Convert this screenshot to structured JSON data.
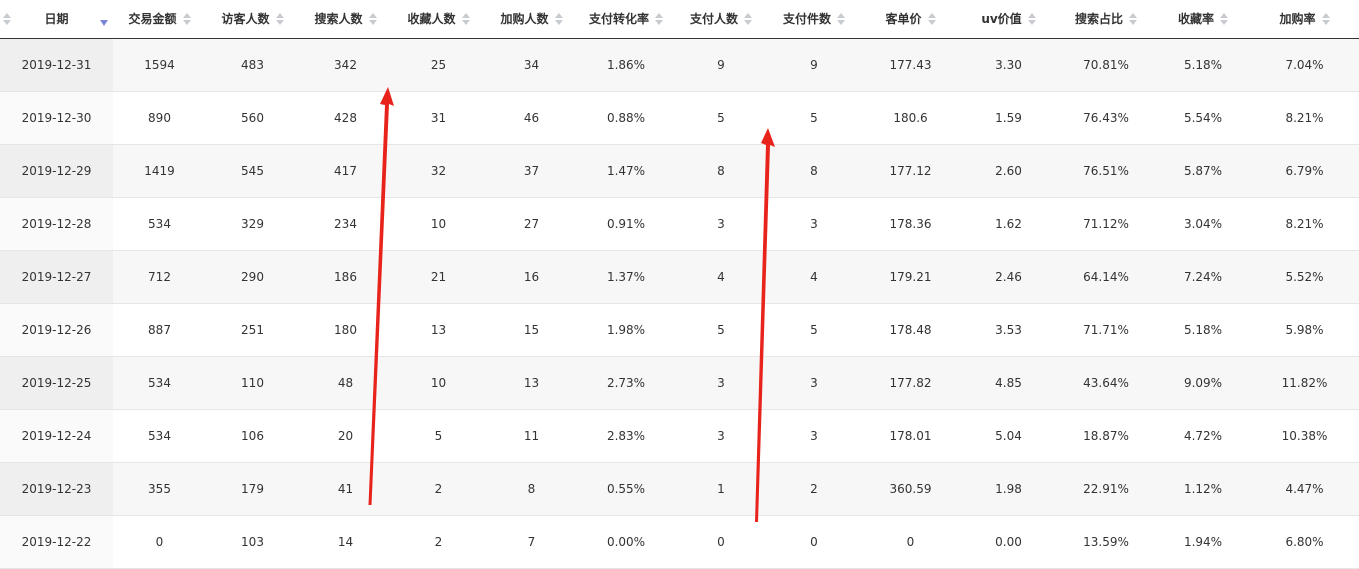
{
  "table": {
    "columns": [
      {
        "key": "date",
        "label": "日期"
      },
      {
        "key": "amount",
        "label": "交易金额"
      },
      {
        "key": "visitors",
        "label": "访客人数"
      },
      {
        "key": "search_users",
        "label": "搜索人数"
      },
      {
        "key": "fav_users",
        "label": "收藏人数"
      },
      {
        "key": "cart_users",
        "label": "加购人数"
      },
      {
        "key": "pay_conv",
        "label": "支付转化率"
      },
      {
        "key": "pay_users",
        "label": "支付人数"
      },
      {
        "key": "pay_items",
        "label": "支付件数"
      },
      {
        "key": "avg_price",
        "label": "客单价"
      },
      {
        "key": "uv_value",
        "label": "uv价值"
      },
      {
        "key": "search_ratio",
        "label": "搜索占比"
      },
      {
        "key": "fav_rate",
        "label": "收藏率"
      },
      {
        "key": "cart_rate",
        "label": "加购率"
      }
    ],
    "rows": [
      [
        "2019-12-31",
        "1594",
        "483",
        "342",
        "25",
        "34",
        "1.86%",
        "9",
        "9",
        "177.43",
        "3.30",
        "70.81%",
        "5.18%",
        "7.04%"
      ],
      [
        "2019-12-30",
        "890",
        "560",
        "428",
        "31",
        "46",
        "0.88%",
        "5",
        "5",
        "180.6",
        "1.59",
        "76.43%",
        "5.54%",
        "8.21%"
      ],
      [
        "2019-12-29",
        "1419",
        "545",
        "417",
        "32",
        "37",
        "1.47%",
        "8",
        "8",
        "177.12",
        "2.60",
        "76.51%",
        "5.87%",
        "6.79%"
      ],
      [
        "2019-12-28",
        "534",
        "329",
        "234",
        "10",
        "27",
        "0.91%",
        "3",
        "3",
        "178.36",
        "1.62",
        "71.12%",
        "3.04%",
        "8.21%"
      ],
      [
        "2019-12-27",
        "712",
        "290",
        "186",
        "21",
        "16",
        "1.37%",
        "4",
        "4",
        "179.21",
        "2.46",
        "64.14%",
        "7.24%",
        "5.52%"
      ],
      [
        "2019-12-26",
        "887",
        "251",
        "180",
        "13",
        "15",
        "1.98%",
        "5",
        "5",
        "178.48",
        "3.53",
        "71.71%",
        "5.18%",
        "5.98%"
      ],
      [
        "2019-12-25",
        "534",
        "110",
        "48",
        "10",
        "13",
        "2.73%",
        "3",
        "3",
        "177.82",
        "4.85",
        "43.64%",
        "9.09%",
        "11.82%"
      ],
      [
        "2019-12-24",
        "534",
        "106",
        "20",
        "5",
        "11",
        "2.83%",
        "3",
        "3",
        "178.01",
        "5.04",
        "18.87%",
        "4.72%",
        "10.38%"
      ],
      [
        "2019-12-23",
        "355",
        "179",
        "41",
        "2",
        "8",
        "0.55%",
        "1",
        "2",
        "360.59",
        "1.98",
        "22.91%",
        "1.12%",
        "4.47%"
      ],
      [
        "2019-12-22",
        "0",
        "103",
        "14",
        "2",
        "7",
        "0.00%",
        "0",
        "0",
        "0",
        "0.00",
        "13.59%",
        "1.94%",
        "6.80%"
      ]
    ]
  },
  "colors": {
    "header_text": "#333333",
    "sort_active": "#7b87d8",
    "sort_inactive": "#c8cbd0",
    "stripe": "#f7f7f7",
    "annotation_arrow": "#e8231c"
  },
  "annotations": [
    {
      "type": "arrow",
      "color": "#e8231c",
      "target": "搜索人数"
    },
    {
      "type": "arrow",
      "color": "#e8231c",
      "target": "支付件数"
    }
  ]
}
